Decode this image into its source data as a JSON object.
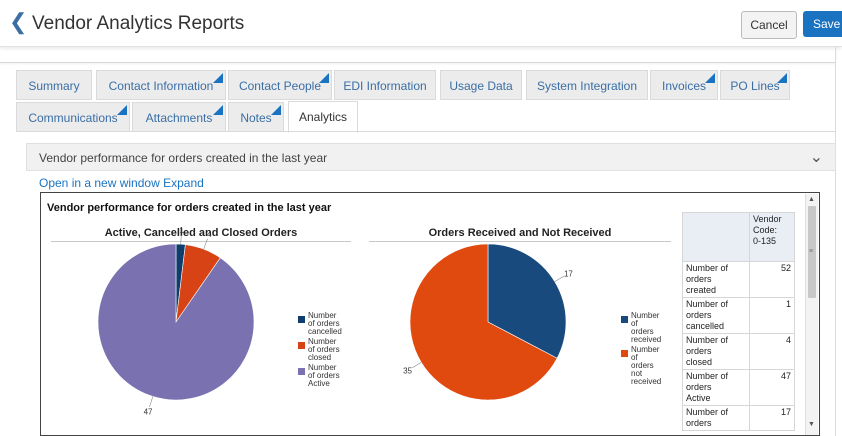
{
  "header": {
    "back_icon": "chevron-left-icon",
    "title": "Vendor Analytics Reports",
    "cancel": "Cancel",
    "save": "Save"
  },
  "tabs": [
    {
      "label": "Summary",
      "flag": false,
      "active": false
    },
    {
      "label": "Contact Information",
      "flag": true,
      "active": false
    },
    {
      "label": "Contact People",
      "flag": true,
      "active": false
    },
    {
      "label": "EDI Information",
      "flag": false,
      "active": false
    },
    {
      "label": "Usage Data",
      "flag": false,
      "active": false
    },
    {
      "label": "System Integration",
      "flag": false,
      "active": false
    },
    {
      "label": "Invoices",
      "flag": true,
      "active": false
    },
    {
      "label": "PO Lines",
      "flag": true,
      "active": false
    },
    {
      "label": "Communications",
      "flag": true,
      "active": false
    },
    {
      "label": "Attachments",
      "flag": true,
      "active": false
    },
    {
      "label": "Notes",
      "flag": true,
      "active": false
    },
    {
      "label": "Analytics",
      "flag": false,
      "active": true
    }
  ],
  "section": {
    "title": "Vendor performance for orders created in the last year",
    "toggle_icon": "chevron-down-icon"
  },
  "links": {
    "open": "Open in a new window",
    "expand": "Expand"
  },
  "report": {
    "title": "Vendor performance for orders created in the last year"
  },
  "colors": {
    "cancelled": "#0f3d6e",
    "closed": "#d84315",
    "active": "#7a72b0",
    "received": "#184a7d",
    "not_received": "#e04a0f",
    "accent": "#1a73c1"
  },
  "chart_data": [
    {
      "type": "pie",
      "title": "Active, Cancelled and Closed Orders",
      "categories": [
        "Number of orders cancelled",
        "Number of orders closed",
        "Number of orders Active"
      ],
      "values": [
        1,
        4,
        47
      ],
      "legend": "right"
    },
    {
      "type": "pie",
      "title": "Orders Received and Not Received",
      "categories": [
        "Number of orders received",
        "Number of orders not received"
      ],
      "values": [
        17,
        35
      ],
      "legend": "right"
    }
  ],
  "table": {
    "header_line1": "Vendor",
    "header_line2": "Code:",
    "header_line3": "0-135",
    "rows": [
      {
        "label1": "Number of",
        "label2": "orders",
        "label3": "created",
        "value": "52"
      },
      {
        "label1": "Number of",
        "label2": "orders",
        "label3": "cancelled",
        "value": "1"
      },
      {
        "label1": "Number of",
        "label2": "orders",
        "label3": "closed",
        "value": "4"
      },
      {
        "label1": "Number of",
        "label2": "orders",
        "label3": "Active",
        "value": "47"
      },
      {
        "label1": "Number of",
        "label2": "orders",
        "label3": "",
        "value": "17"
      }
    ]
  }
}
